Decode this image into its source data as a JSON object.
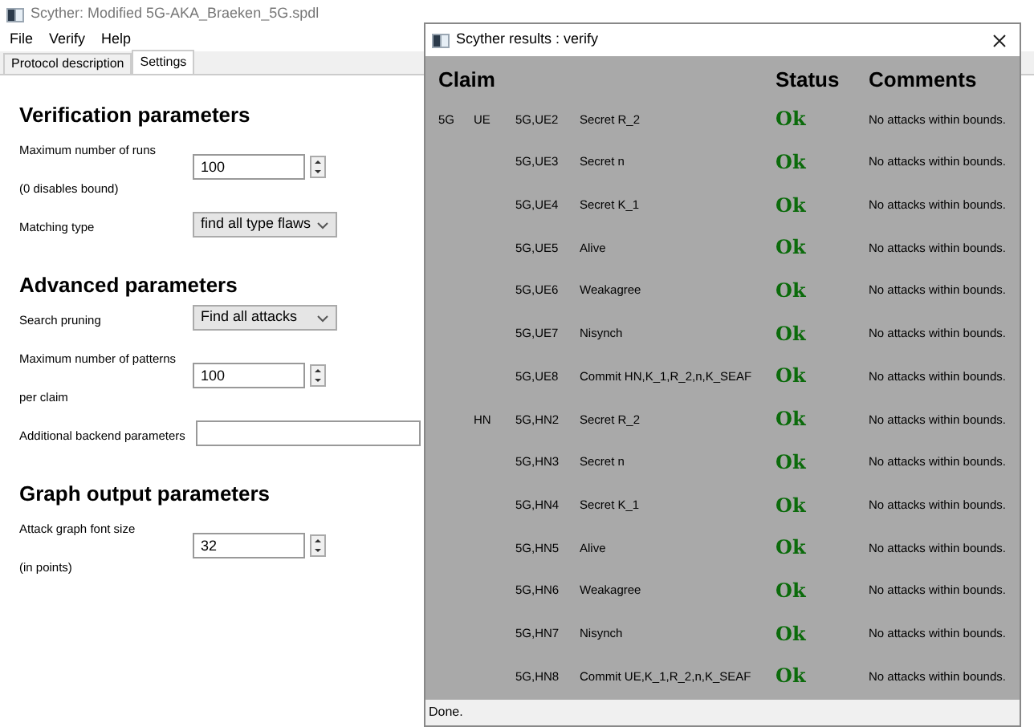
{
  "window": {
    "title": "Scyther: Modified 5G-AKA_Braeken_5G.spdl"
  },
  "menu": [
    "File",
    "Verify",
    "Help"
  ],
  "tabs": [
    {
      "label": "Protocol description",
      "selected": false
    },
    {
      "label": "Settings",
      "selected": true
    }
  ],
  "sections": [
    {
      "title": "Verification parameters",
      "fields": [
        {
          "kind": "spin",
          "label": "Maximum number of runs\n(0 disables bound)",
          "value": "100"
        },
        {
          "kind": "select",
          "label": "Matching type",
          "value": "find all type flaws"
        }
      ]
    },
    {
      "title": "Advanced parameters",
      "fields": [
        {
          "kind": "select",
          "label": "Search pruning",
          "value": "Find all attacks"
        },
        {
          "kind": "spin",
          "label": "Maximum number of patterns\nper claim",
          "value": "100"
        },
        {
          "kind": "text",
          "label": "Additional backend parameters"
        }
      ]
    },
    {
      "title": "Graph output parameters",
      "fields": [
        {
          "kind": "spin",
          "label": "Attack graph font size\n(in points)",
          "value": "32"
        }
      ]
    }
  ],
  "results": {
    "title": "Scyther results : verify",
    "headers": [
      "Claim",
      "Status",
      "Comments"
    ],
    "rows": [
      {
        "protocol": "5G",
        "role": "UE",
        "id": "5G,UE2",
        "claim": "Secret R_2",
        "status": "Ok",
        "comment": "No attacks within bounds."
      },
      {
        "id": "5G,UE3",
        "claim": "Secret n",
        "status": "Ok",
        "comment": "No attacks within bounds."
      },
      {
        "id": "5G,UE4",
        "claim": "Secret K_1",
        "status": "Ok",
        "comment": "No attacks within bounds."
      },
      {
        "id": "5G,UE5",
        "claim": "Alive",
        "status": "Ok",
        "comment": "No attacks within bounds."
      },
      {
        "id": "5G,UE6",
        "claim": "Weakagree",
        "status": "Ok",
        "comment": "No attacks within bounds."
      },
      {
        "id": "5G,UE7",
        "claim": "Nisynch",
        "status": "Ok",
        "comment": "No attacks within bounds."
      },
      {
        "id": "5G,UE8",
        "claim": "Commit HN,K_1,R_2,n,K_SEAF",
        "status": "Ok",
        "comment": "No attacks within bounds."
      },
      {
        "role": "HN",
        "id": "5G,HN2",
        "claim": "Secret R_2",
        "status": "Ok",
        "comment": "No attacks within bounds."
      },
      {
        "id": "5G,HN3",
        "claim": "Secret n",
        "status": "Ok",
        "comment": "No attacks within bounds."
      },
      {
        "id": "5G,HN4",
        "claim": "Secret K_1",
        "status": "Ok",
        "comment": "No attacks within bounds."
      },
      {
        "id": "5G,HN5",
        "claim": "Alive",
        "status": "Ok",
        "comment": "No attacks within bounds."
      },
      {
        "id": "5G,HN6",
        "claim": "Weakagree",
        "status": "Ok",
        "comment": "No attacks within bounds."
      },
      {
        "id": "5G,HN7",
        "claim": "Nisynch",
        "status": "Ok",
        "comment": "No attacks within bounds."
      },
      {
        "id": "5G,HN8",
        "claim": "Commit UE,K_1,R_2,n,K_SEAF",
        "status": "Ok",
        "comment": "No attacks within bounds."
      }
    ],
    "status_bar": "Done."
  }
}
